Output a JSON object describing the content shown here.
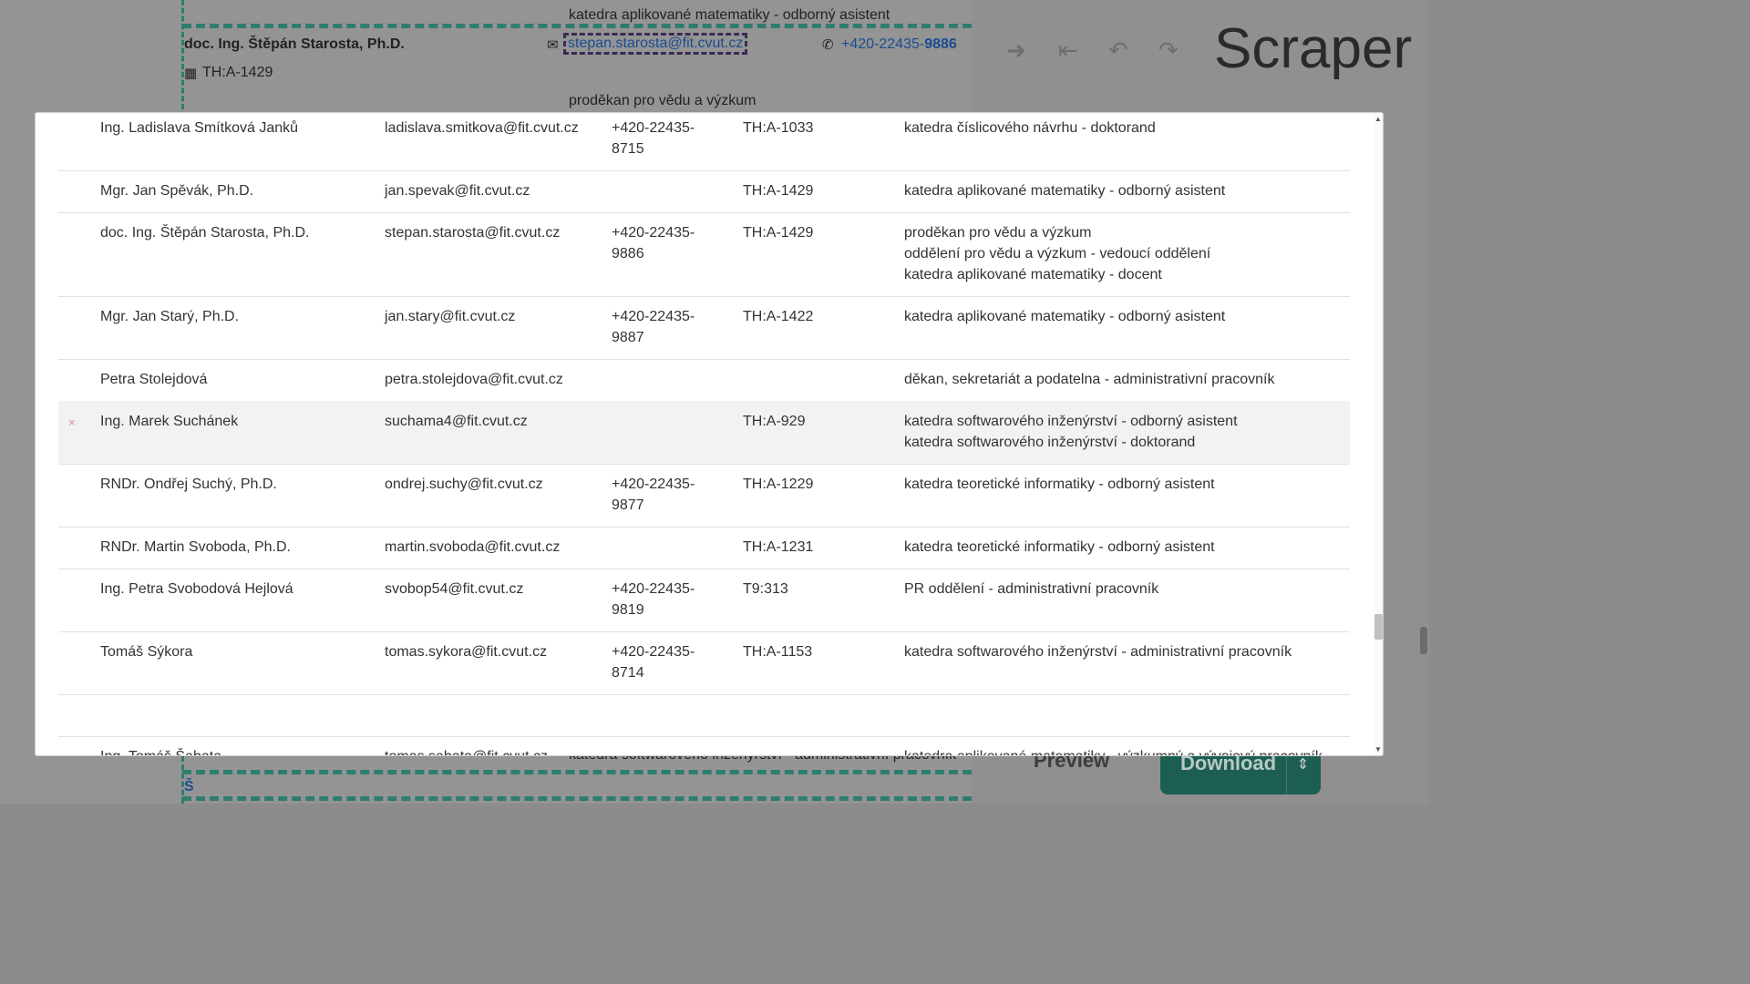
{
  "background_page": {
    "top_role": "katedra aplikované matematiky - odborný asistent",
    "person_name": "doc. Ing. Štěpán Starosta, Ph.D.",
    "email": "stepan.starosta@fit.cvut.cz",
    "phone_prefix": "+420-22435-",
    "phone_suffix": "9886",
    "room": "TH:A-1429",
    "role_line": "proděkan pro vědu a výzkum",
    "bottom_role": "katedra softwarového inženýrství - administrativní pracovník",
    "bottom_letter": "Š",
    "icons": {
      "email": "envelope-icon",
      "phone": "phone-icon",
      "room": "building-icon"
    }
  },
  "scraper": {
    "title": "Scraper",
    "toolbar": {
      "next": "➜",
      "first": "⇤",
      "undo": "↶",
      "redo": "↷"
    },
    "preview_label": "Preview",
    "download_label": "Download",
    "download_caret": "⇕",
    "accent_color": "#1d5e52"
  },
  "rows": [
    {
      "name": "Ing. Ladislava Smítková Janků",
      "email": "ladislava.smitkova@fit.cvut.cz",
      "phone": "+420-22435-8715",
      "room": "TH:A-1033",
      "roles": [
        "katedra číslicového návrhu - doktorand"
      ]
    },
    {
      "name": "Mgr. Jan Spěvák, Ph.D.",
      "email": "jan.spevak@fit.cvut.cz",
      "phone": "",
      "room": "TH:A-1429",
      "roles": [
        "katedra aplikované matematiky - odborný asistent"
      ]
    },
    {
      "name": "doc. Ing. Štěpán Starosta, Ph.D.",
      "email": "stepan.starosta@fit.cvut.cz",
      "phone": "+420-22435-9886",
      "room": "TH:A-1429",
      "roles": [
        "proděkan pro vědu a výzkum",
        "oddělení pro vědu a výzkum - vedoucí oddělení",
        "katedra aplikované matematiky - docent"
      ]
    },
    {
      "name": "Mgr. Jan Starý, Ph.D.",
      "email": "jan.stary@fit.cvut.cz",
      "phone": "+420-22435-9887",
      "room": "TH:A-1422",
      "roles": [
        "katedra aplikované matematiky - odborný asistent"
      ]
    },
    {
      "name": "Petra Stolejdová",
      "email": "petra.stolejdova@fit.cvut.cz",
      "phone": "",
      "room": "",
      "roles": [
        "děkan, sekretariát a podatelna - administrativní pracovník"
      ]
    },
    {
      "name": "Ing. Marek Suchánek",
      "email": "suchama4@fit.cvut.cz",
      "phone": "",
      "room": "TH:A-929",
      "roles": [
        "katedra softwarového inženýrství - odborný asistent",
        "katedra softwarového inženýrství - doktorand"
      ],
      "highlighted": true,
      "remove_icon": "×"
    },
    {
      "name": "RNDr. Ondřej Suchý, Ph.D.",
      "email": "ondrej.suchy@fit.cvut.cz",
      "phone": "+420-22435-9877",
      "room": "TH:A-1229",
      "roles": [
        "katedra teoretické informatiky - odborný asistent"
      ]
    },
    {
      "name": "RNDr. Martin Svoboda, Ph.D.",
      "email": "martin.svoboda@fit.cvut.cz",
      "phone": "",
      "room": "TH:A-1231",
      "roles": [
        "katedra teoretické informatiky - odborný asistent"
      ]
    },
    {
      "name": "Ing. Petra Svobodová Hejlová",
      "email": "svobop54@fit.cvut.cz",
      "phone": "+420-22435-9819",
      "room": "T9:313",
      "roles": [
        "PR oddělení - administrativní pracovník"
      ]
    },
    {
      "name": "Tomáš Sýkora",
      "email": "tomas.sykora@fit.cvut.cz",
      "phone": "+420-22435-8714",
      "room": "TH:A-1153",
      "roles": [
        "katedra softwarového inženýrství - administrativní pracovník"
      ]
    },
    {
      "name": "",
      "email": "",
      "phone": "",
      "room": "",
      "roles": []
    },
    {
      "name": "Ing. Tomáš Šabata",
      "email": "tomas.sabata@fit.cvut.cz",
      "phone": "",
      "room": "",
      "roles": [
        "katedra aplikované matematiky - výzkumný a vývojový pracovník"
      ]
    }
  ]
}
